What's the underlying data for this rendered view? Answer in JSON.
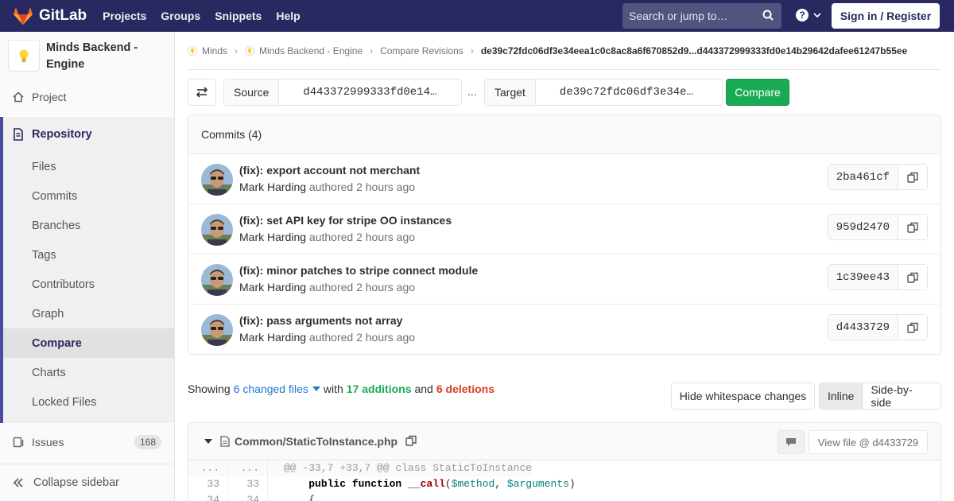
{
  "header": {
    "brand": "GitLab",
    "nav": [
      "Projects",
      "Groups",
      "Snippets",
      "Help"
    ],
    "search_placeholder": "Search or jump to…",
    "help_glyph": "?",
    "signin_label": "Sign in / Register",
    "colors": {
      "bg": "#292961"
    }
  },
  "sidebar": {
    "project_name": "Minds Backend - Engine",
    "project_label": "Project",
    "repository_label": "Repository",
    "repo_items": [
      "Files",
      "Commits",
      "Branches",
      "Tags",
      "Contributors",
      "Graph",
      "Compare",
      "Charts",
      "Locked Files"
    ],
    "active_item": "Compare",
    "issues_label": "Issues",
    "issues_count": "168",
    "collapse_label": "Collapse sidebar"
  },
  "breadcrumb": {
    "items": [
      "Minds",
      "Minds Backend - Engine",
      "Compare Revisions"
    ],
    "current": "de39c72fdc06df3e34eea1c0c8ac8a6f670852d9...d443372999333fd0e14b29642dafee61247b55ee"
  },
  "compare": {
    "source_label": "Source",
    "source_value": "d443372999333fd0e14…",
    "separator": "...",
    "target_label": "Target",
    "target_value": "de39c72fdc06df3e34e…",
    "button_label": "Compare"
  },
  "commits": {
    "header": "Commits (4)",
    "items": [
      {
        "title": "(fix): export account not merchant",
        "author": "Mark Harding",
        "verb": "authored",
        "time": "2 hours ago",
        "sha": "2ba461cf"
      },
      {
        "title": "(fix): set API key for stripe OO instances",
        "author": "Mark Harding",
        "verb": "authored",
        "time": "2 hours ago",
        "sha": "959d2470"
      },
      {
        "title": "(fix): minor patches to stripe connect module",
        "author": "Mark Harding",
        "verb": "authored",
        "time": "2 hours ago",
        "sha": "1c39ee43"
      },
      {
        "title": "(fix): pass arguments not array",
        "author": "Mark Harding",
        "verb": "authored",
        "time": "2 hours ago",
        "sha": "d4433729"
      }
    ]
  },
  "summary": {
    "showing": "Showing",
    "changed_files": "6 changed files",
    "with": "with",
    "additions": "17 additions",
    "and": "and",
    "deletions": "6 deletions",
    "hide_ws_label": "Hide whitespace changes",
    "inline_label": "Inline",
    "side_label": "Side-by-side"
  },
  "diff_file": {
    "path": "Common/StaticToInstance.php",
    "view_file_label": "View file @ d4433729",
    "lines": [
      {
        "old": "...",
        "new": "...",
        "text": "@@ -33,7 +33,7 @@ class StaticToInstance"
      },
      {
        "old": "33",
        "new": "33"
      },
      {
        "old": "34",
        "new": "34",
        "text": "    {"
      }
    ],
    "line33": {
      "kw": "public function",
      "fn": "__call",
      "var1": "$method",
      "var2": "$arguments"
    }
  }
}
